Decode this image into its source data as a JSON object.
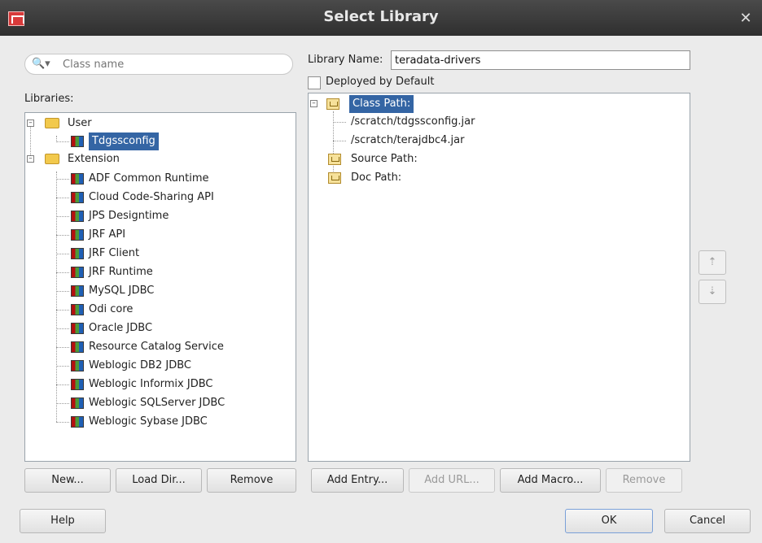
{
  "window": {
    "title": "Select Library"
  },
  "search": {
    "placeholder": "Class name"
  },
  "left": {
    "libraries_label": "Libraries:",
    "tree": [
      {
        "label": "User",
        "level": 0,
        "type": "folder"
      },
      {
        "label": "Tdgssconfig",
        "level": 1,
        "type": "lib",
        "selected": true
      },
      {
        "label": "Extension",
        "level": 0,
        "type": "folder"
      },
      {
        "label": "ADF Common Runtime",
        "level": 1,
        "type": "lib"
      },
      {
        "label": "Cloud Code-Sharing API",
        "level": 1,
        "type": "lib"
      },
      {
        "label": "JPS Designtime",
        "level": 1,
        "type": "lib"
      },
      {
        "label": "JRF API",
        "level": 1,
        "type": "lib"
      },
      {
        "label": "JRF Client",
        "level": 1,
        "type": "lib"
      },
      {
        "label": "JRF Runtime",
        "level": 1,
        "type": "lib"
      },
      {
        "label": "MySQL JDBC",
        "level": 1,
        "type": "lib"
      },
      {
        "label": "Odi core",
        "level": 1,
        "type": "lib"
      },
      {
        "label": "Oracle JDBC",
        "level": 1,
        "type": "lib"
      },
      {
        "label": "Resource Catalog Service",
        "level": 1,
        "type": "lib"
      },
      {
        "label": "Weblogic DB2 JDBC",
        "level": 1,
        "type": "lib"
      },
      {
        "label": "Weblogic Informix JDBC",
        "level": 1,
        "type": "lib"
      },
      {
        "label": "Weblogic SQLServer JDBC",
        "level": 1,
        "type": "lib"
      },
      {
        "label": "Weblogic Sybase JDBC",
        "level": 1,
        "type": "lib"
      }
    ],
    "buttons": {
      "new": "New...",
      "load_dir": "Load Dir...",
      "remove": "Remove"
    }
  },
  "right": {
    "library_name_label": "Library Name:",
    "library_name_value": "teradata-drivers",
    "deployed_label": "Deployed by Default",
    "tree": [
      {
        "label": "Class Path:",
        "level": 0,
        "type": "cp",
        "selected": true
      },
      {
        "label": "/scratch/tdgssconfig.jar",
        "level": 1,
        "type": "file"
      },
      {
        "label": "/scratch/terajdbc4.jar",
        "level": 1,
        "type": "file"
      },
      {
        "label": "Source Path:",
        "level": 0,
        "type": "cp"
      },
      {
        "label": "Doc Path:",
        "level": 0,
        "type": "cp"
      }
    ],
    "buttons": {
      "add_entry": "Add Entry...",
      "add_url": "Add URL...",
      "add_macro": "Add Macro...",
      "remove": "Remove"
    }
  },
  "footer": {
    "help": "Help",
    "ok": "OK",
    "cancel": "Cancel"
  }
}
